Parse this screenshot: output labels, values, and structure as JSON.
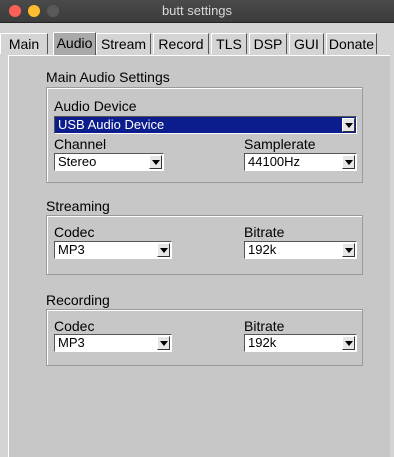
{
  "window": {
    "title": "butt settings"
  },
  "tabs": [
    {
      "label": "Main"
    },
    {
      "label": "Audio"
    },
    {
      "label": "Stream"
    },
    {
      "label": "Record"
    },
    {
      "label": "TLS"
    },
    {
      "label": "DSP"
    },
    {
      "label": "GUI"
    },
    {
      "label": "Donate"
    }
  ],
  "active_tab": "Audio",
  "main_audio": {
    "title": "Main Audio Settings",
    "device_label": "Audio Device",
    "device_value": "USB Audio Device",
    "channel_label": "Channel",
    "channel_value": "Stereo",
    "samplerate_label": "Samplerate",
    "samplerate_value": "44100Hz"
  },
  "streaming": {
    "title": "Streaming",
    "codec_label": "Codec",
    "codec_value": "MP3",
    "bitrate_label": "Bitrate",
    "bitrate_value": "192k"
  },
  "recording": {
    "title": "Recording",
    "codec_label": "Codec",
    "codec_value": "MP3",
    "bitrate_label": "Bitrate",
    "bitrate_value": "192k"
  },
  "icons": [
    "close-icon",
    "minimize-icon",
    "maximize-icon",
    "chevron-down-icon"
  ]
}
